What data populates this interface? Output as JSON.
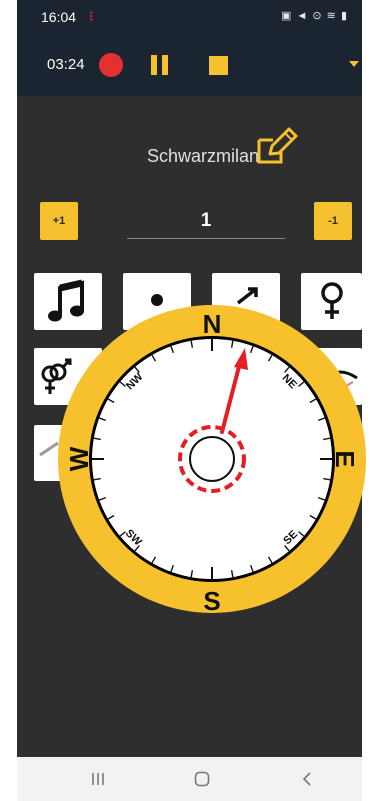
{
  "status_bar": {
    "time": "16:04",
    "alert_glyph": "⁝",
    "icons_text": "▣ ◄ ⊙ ≋ ▮",
    "icons": [
      "photo-icon",
      "mute-icon",
      "location-icon",
      "wifi-icon",
      "signal-icon",
      "battery-icon"
    ]
  },
  "toolbar": {
    "elapsed": "03:24",
    "record_color": "#e53030",
    "accent_color": "#f5c12e"
  },
  "species": {
    "name": "Schwarzmilan"
  },
  "counter": {
    "plus_label": "+1",
    "minus_label": "-1",
    "value": "1"
  },
  "attribute_tiles": [
    "music-note-icon",
    "sitting-bird-icon",
    "male-icon",
    "female-icon",
    "pair-icon",
    "flying-bird-icon"
  ],
  "compass": {
    "north": "N",
    "east": "E",
    "south": "S",
    "west": "W",
    "northwest": "NW",
    "northeast": "NE",
    "southeast": "SE",
    "southwest": "SW",
    "bezel_color": "#f7c02d",
    "needle_color": "#e31e24"
  },
  "nav_bar": {
    "icons": [
      "recent-apps-icon",
      "home-icon",
      "back-icon"
    ]
  }
}
